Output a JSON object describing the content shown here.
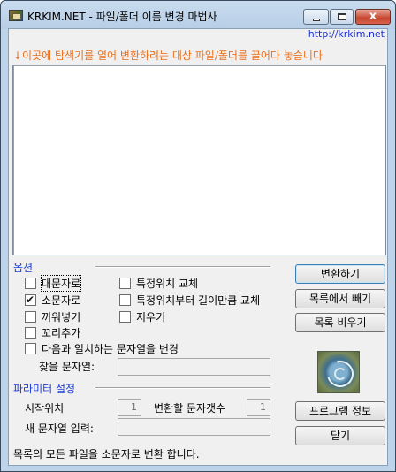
{
  "window": {
    "title": "KRKIM.NET - 파일/폴더 이름 변경 마법사",
    "close_glyph": "x"
  },
  "header": {
    "site_link": "http://krkim.net",
    "drop_hint": "↓이곳에 탐색기를 열어 변환하려는 대상 파일/폴더를 끌어다 놓습니다"
  },
  "file_list": {
    "items": []
  },
  "options": {
    "label": "옵션",
    "uppercase": {
      "label": "대문자로",
      "checked": false
    },
    "lowercase": {
      "label": "소문자로",
      "checked": true
    },
    "insert": {
      "label": "끼워넣기",
      "checked": false
    },
    "append_suffix": {
      "label": "꼬리추가",
      "checked": false
    },
    "replace_at_position": {
      "label": "특정위치 교체",
      "checked": false
    },
    "replace_length_from_position": {
      "label": "특정위치부터 길이만큼 교체",
      "checked": false
    },
    "erase": {
      "label": "지우기",
      "checked": false
    },
    "replace_matching": {
      "label": "다음과 일치하는 문자열을 변경",
      "checked": false
    },
    "find_string": {
      "label": "찾을 문자열:",
      "value": ""
    }
  },
  "parameters": {
    "label": "파라미터 설정",
    "start_position": {
      "label": "시작위치",
      "value": "1"
    },
    "char_count": {
      "label": "변환할 문자갯수",
      "value": "1"
    },
    "new_string": {
      "label": "새 문자열 입력:",
      "value": ""
    }
  },
  "buttons": {
    "convert": "변환하기",
    "remove_from_list": "목록에서 빼기",
    "clear_list": "목록 비우기",
    "program_info": "프로그램 정보",
    "close": "닫기"
  },
  "status": "목록의 모든 파일을 소문자로 변환 합니다."
}
